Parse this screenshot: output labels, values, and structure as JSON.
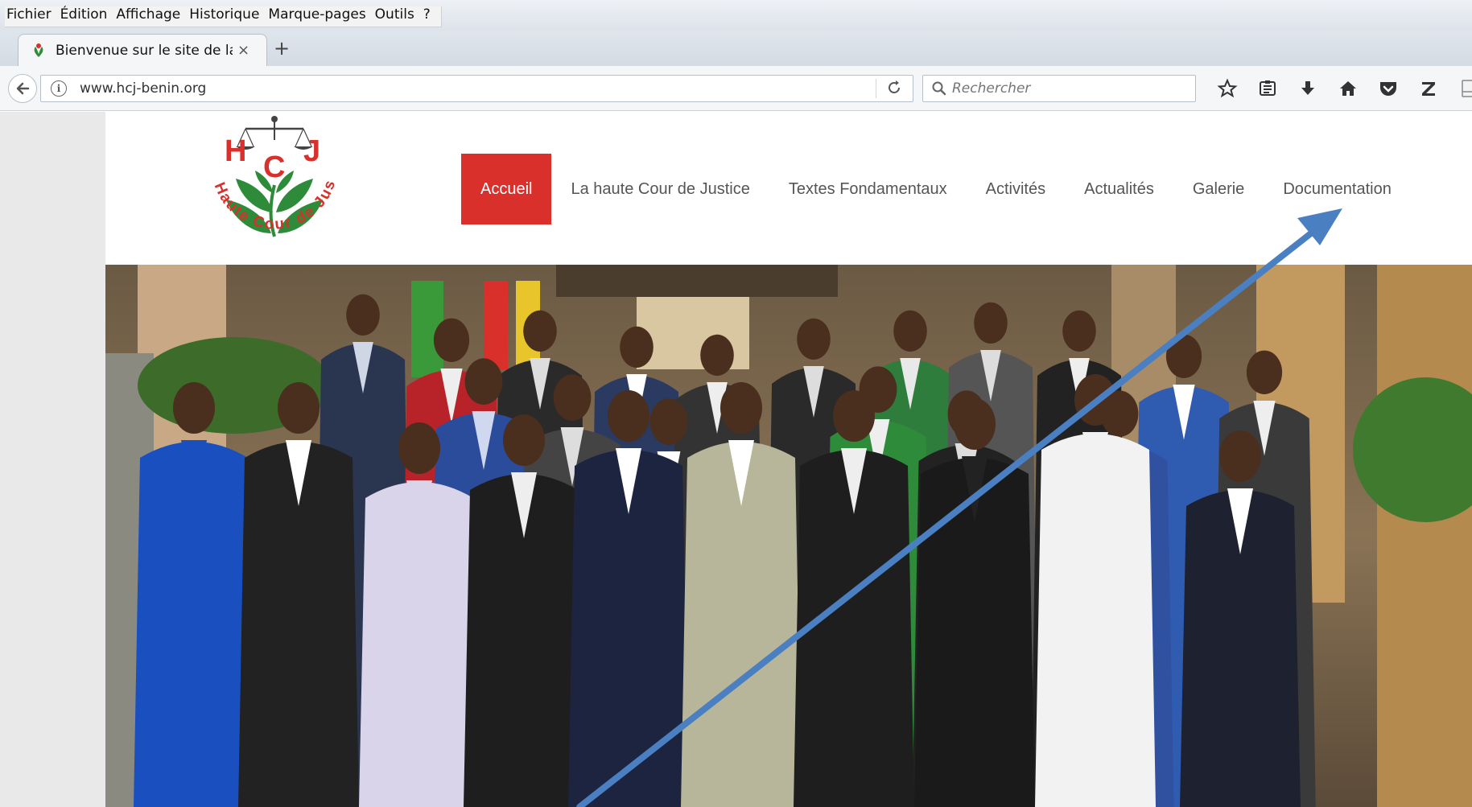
{
  "menubar": {
    "items": [
      "Fichier",
      "Édition",
      "Affichage",
      "Historique",
      "Marque-pages",
      "Outils",
      "?"
    ]
  },
  "tab": {
    "title": "Bienvenue sur le site de la haute",
    "close": "×",
    "new_tab": "+"
  },
  "navbar": {
    "url": "www.hcj-benin.org",
    "search_placeholder": "Rechercher"
  },
  "logo": {
    "letters": [
      "H",
      "C",
      "J"
    ],
    "tagline": "Haute Cour de Justice"
  },
  "site_nav": {
    "items": [
      "Accueil",
      "La haute Cour de Justice",
      "Textes Fondamentaux",
      "Activités",
      "Actualités",
      "Galerie",
      "Documentation"
    ],
    "active": "Accueil"
  },
  "colors": {
    "nav_active_bg": "#d9302c",
    "annotation_arrow": "#4a7fc1",
    "logo_red": "#d9302c",
    "logo_green": "#2e8b3a"
  },
  "icons": {
    "toolbar": [
      "star-icon",
      "reading-list-icon",
      "download-icon",
      "home-icon",
      "pocket-icon",
      "zotero-icon",
      "page-icon"
    ]
  }
}
